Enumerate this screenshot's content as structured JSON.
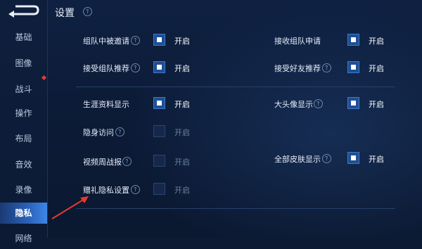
{
  "header": {
    "title": "设置"
  },
  "sidebar": {
    "items": [
      "基础",
      "图像",
      "战斗",
      "操作",
      "布局",
      "音效",
      "录像",
      "隐私",
      "网络"
    ],
    "active": "隐私"
  },
  "settings": {
    "on_label": "开启",
    "rows": [
      {
        "label": "组队中被邀请",
        "help": true,
        "enabled": true
      },
      {
        "label": "接收组队申请",
        "help": false,
        "enabled": true
      },
      {
        "label": "接受组队推荐",
        "help": true,
        "enabled": true
      },
      {
        "label": "接受好友推荐",
        "help": true,
        "enabled": true
      },
      {
        "label": "生涯资料显示",
        "help": false,
        "enabled": true
      },
      {
        "label": "大头像显示",
        "help": true,
        "enabled": true
      },
      {
        "label": "隐身访问",
        "help": true,
        "enabled": false
      },
      {
        "label": "视频周战报",
        "help": true,
        "enabled": false
      },
      {
        "label": "全部皮肤显示",
        "help": true,
        "enabled": true
      },
      {
        "label": "赠礼隐私设置",
        "help": true,
        "enabled": false
      }
    ]
  },
  "colors": {
    "accent": "#2a62b8",
    "annotation_arrow": "#e23b30"
  }
}
